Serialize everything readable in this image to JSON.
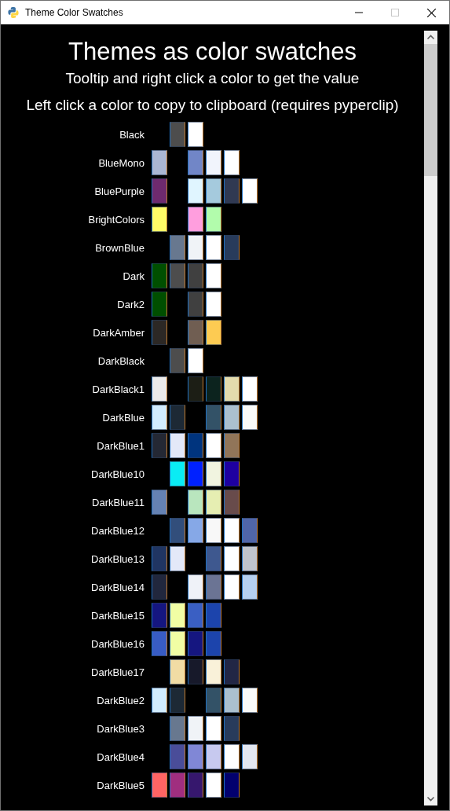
{
  "window": {
    "title": "Theme Color Swatches"
  },
  "heading": "Themes as color swatches",
  "instructions": [
    "Tooltip and right click a color to get the value",
    "Left click a color to copy to clipboard (requires pyperclip)"
  ],
  "themes": [
    {
      "name": "Black",
      "swatches": [
        {
          "kind": "blank"
        },
        {
          "kind": "color",
          "color": "#4d4d4d"
        },
        {
          "kind": "color",
          "color": "#ffffff"
        }
      ]
    },
    {
      "name": "BlueMono",
      "swatches": [
        {
          "kind": "color",
          "color": "#aab6d3"
        },
        {
          "kind": "blank"
        },
        {
          "kind": "color",
          "color": "#7186c7"
        },
        {
          "kind": "color",
          "color": "#f1f4fc"
        },
        {
          "kind": "color",
          "color": "#ffffff"
        }
      ]
    },
    {
      "name": "BluePurple",
      "swatches": [
        {
          "kind": "color",
          "color": "#6e2a6e"
        },
        {
          "kind": "blank"
        },
        {
          "kind": "color",
          "color": "#e0f5ff"
        },
        {
          "kind": "color",
          "color": "#a5cadd"
        },
        {
          "kind": "color",
          "color": "#303952"
        },
        {
          "kind": "color",
          "color": "#ffffff"
        }
      ]
    },
    {
      "name": "BrightColors",
      "swatches": [
        {
          "kind": "color",
          "color": "#fefb67"
        },
        {
          "kind": "blank"
        },
        {
          "kind": "color",
          "color": "#ff9ede"
        },
        {
          "kind": "color",
          "color": "#b2fcac"
        }
      ]
    },
    {
      "name": "BrownBlue",
      "swatches": [
        {
          "kind": "blank"
        },
        {
          "kind": "color",
          "color": "#68788f"
        },
        {
          "kind": "color",
          "color": "#f0f3f7"
        },
        {
          "kind": "color",
          "color": "#ffffff"
        },
        {
          "kind": "color",
          "color": "#283b5b"
        }
      ]
    },
    {
      "name": "Dark",
      "swatches": [
        {
          "kind": "color",
          "color": "#004f00"
        },
        {
          "kind": "color",
          "color": "#4d4d4d"
        },
        {
          "kind": "color",
          "color": "#404040"
        },
        {
          "kind": "color",
          "color": "#ffffff"
        }
      ]
    },
    {
      "name": "Dark2",
      "swatches": [
        {
          "kind": "color",
          "color": "#004f00"
        },
        {
          "kind": "blank"
        },
        {
          "kind": "color",
          "color": "#404040"
        },
        {
          "kind": "color",
          "color": "#ffffff"
        }
      ]
    },
    {
      "name": "DarkAmber",
      "swatches": [
        {
          "kind": "color",
          "color": "#2c2825"
        },
        {
          "kind": "blank"
        },
        {
          "kind": "color",
          "color": "#705e52"
        },
        {
          "kind": "color",
          "color": "#fdcb52"
        }
      ]
    },
    {
      "name": "DarkBlack",
      "swatches": [
        {
          "kind": "blank"
        },
        {
          "kind": "color",
          "color": "#4d4d4d"
        },
        {
          "kind": "color",
          "color": "#ffffff"
        }
      ]
    },
    {
      "name": "DarkBlack1",
      "swatches": [
        {
          "kind": "color",
          "color": "#ebebeb"
        },
        {
          "kind": "blank"
        },
        {
          "kind": "color",
          "color": "#1c1e15"
        },
        {
          "kind": "color",
          "color": "#0c231e"
        },
        {
          "kind": "color",
          "color": "#e3dbad"
        },
        {
          "kind": "color",
          "color": "#ffffff"
        }
      ]
    },
    {
      "name": "DarkBlue",
      "swatches": [
        {
          "kind": "color",
          "color": "#d1ecff"
        },
        {
          "kind": "color",
          "color": "#1d2935"
        },
        {
          "kind": "blank"
        },
        {
          "kind": "color",
          "color": "#335267"
        },
        {
          "kind": "color",
          "color": "#abc0cf"
        },
        {
          "kind": "color",
          "color": "#fafaf8"
        }
      ]
    },
    {
      "name": "DarkBlue1",
      "swatches": [
        {
          "kind": "color",
          "color": "#242834"
        },
        {
          "kind": "color",
          "color": "#e3e8f8"
        },
        {
          "kind": "color",
          "color": "#00347e"
        },
        {
          "kind": "color",
          "color": "#ffffff"
        },
        {
          "kind": "color",
          "color": "#917559"
        }
      ]
    },
    {
      "name": "DarkBlue10",
      "swatches": [
        {
          "kind": "blank"
        },
        {
          "kind": "color",
          "color": "#0aecf4"
        },
        {
          "kind": "color",
          "color": "#0021ff"
        },
        {
          "kind": "color",
          "color": "#f1f4e0"
        },
        {
          "kind": "color",
          "color": "#1e00a0"
        }
      ]
    },
    {
      "name": "DarkBlue11",
      "swatches": [
        {
          "kind": "color",
          "color": "#6582b3"
        },
        {
          "kind": "blank"
        },
        {
          "kind": "color",
          "color": "#b9e6be"
        },
        {
          "kind": "color",
          "color": "#e6eeb2"
        },
        {
          "kind": "color",
          "color": "#684b4b"
        }
      ]
    },
    {
      "name": "DarkBlue12",
      "swatches": [
        {
          "kind": "blank"
        },
        {
          "kind": "color",
          "color": "#324e7b"
        },
        {
          "kind": "color",
          "color": "#86a8e7"
        },
        {
          "kind": "color",
          "color": "#f8f8f8"
        },
        {
          "kind": "color",
          "color": "#ffffff"
        },
        {
          "kind": "color",
          "color": "#5065a8"
        }
      ]
    },
    {
      "name": "DarkBlue13",
      "swatches": [
        {
          "kind": "color",
          "color": "#203562"
        },
        {
          "kind": "color",
          "color": "#e3e8f8"
        },
        {
          "kind": "blank"
        },
        {
          "kind": "color",
          "color": "#3e588f"
        },
        {
          "kind": "color",
          "color": "#ffffff"
        },
        {
          "kind": "color",
          "color": "#c0c4cc"
        }
      ]
    },
    {
      "name": "DarkBlue14",
      "swatches": [
        {
          "kind": "color",
          "color": "#21273d"
        },
        {
          "kind": "blank"
        },
        {
          "kind": "color",
          "color": "#eff2f8"
        },
        {
          "kind": "color",
          "color": "#6b7494"
        },
        {
          "kind": "color",
          "color": "#ffffff"
        },
        {
          "kind": "color",
          "color": "#b6d0f0"
        }
      ]
    },
    {
      "name": "DarkBlue15",
      "swatches": [
        {
          "kind": "color",
          "color": "#151680"
        },
        {
          "kind": "color",
          "color": "#f1fea4"
        },
        {
          "kind": "color",
          "color": "#3a5fc3"
        },
        {
          "kind": "color",
          "color": "#1c44ac"
        }
      ]
    },
    {
      "name": "DarkBlue16",
      "swatches": [
        {
          "kind": "color",
          "color": "#385cc4"
        },
        {
          "kind": "color",
          "color": "#f1fea4"
        },
        {
          "kind": "color",
          "color": "#151680"
        },
        {
          "kind": "color",
          "color": "#1c44ac"
        }
      ]
    },
    {
      "name": "DarkBlue17",
      "swatches": [
        {
          "kind": "blank"
        },
        {
          "kind": "color",
          "color": "#f1dca4"
        },
        {
          "kind": "color",
          "color": "#17192a"
        },
        {
          "kind": "color",
          "color": "#f9f1d9"
        },
        {
          "kind": "color",
          "color": "#222645"
        }
      ]
    },
    {
      "name": "DarkBlue2",
      "swatches": [
        {
          "kind": "color",
          "color": "#d1ecff"
        },
        {
          "kind": "color",
          "color": "#1d2935"
        },
        {
          "kind": "blank"
        },
        {
          "kind": "color",
          "color": "#335267"
        },
        {
          "kind": "color",
          "color": "#abc0cf"
        },
        {
          "kind": "color",
          "color": "#fafaf8"
        }
      ]
    },
    {
      "name": "DarkBlue3",
      "swatches": [
        {
          "kind": "blank"
        },
        {
          "kind": "color",
          "color": "#68788f"
        },
        {
          "kind": "color",
          "color": "#f0f3f7"
        },
        {
          "kind": "color",
          "color": "#ffffff"
        },
        {
          "kind": "color",
          "color": "#283b5b"
        }
      ]
    },
    {
      "name": "DarkBlue4",
      "swatches": [
        {
          "kind": "blank"
        },
        {
          "kind": "color",
          "color": "#4a4d99"
        },
        {
          "kind": "color",
          "color": "#8087d6"
        },
        {
          "kind": "color",
          "color": "#c7c9ef"
        },
        {
          "kind": "color",
          "color": "#ffffff"
        },
        {
          "kind": "color",
          "color": "#e3e7f1"
        }
      ]
    },
    {
      "name": "DarkBlue5",
      "swatches": [
        {
          "kind": "color",
          "color": "#ff6464"
        },
        {
          "kind": "color",
          "color": "#a02e7f"
        },
        {
          "kind": "color",
          "color": "#36176d"
        },
        {
          "kind": "color",
          "color": "#ffffff"
        },
        {
          "kind": "color",
          "color": "#02006e"
        }
      ]
    }
  ]
}
